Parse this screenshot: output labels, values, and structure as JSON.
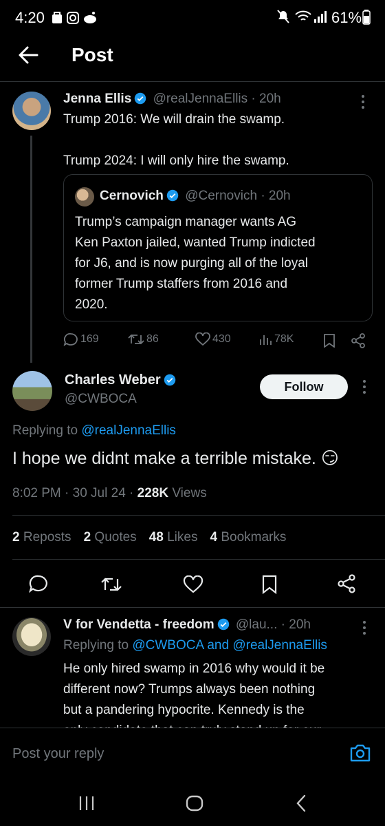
{
  "status": {
    "time": "4:20",
    "battery": "61%"
  },
  "header": {
    "title": "Post"
  },
  "tweet1": {
    "name": "Jenna Ellis",
    "handle": "@realJennaEllis",
    "time": "· 20h",
    "line1": "Trump 2016: We will drain the swamp.",
    "line2": "Trump 2024: I will only hire the swamp.",
    "quote": {
      "name": "Cernovich",
      "handle": "@Cernovich",
      "time": "· 20h",
      "lines": [
        "Trump’s campaign manager wants AG",
        "Ken Paxton jailed, wanted Trump indicted",
        "for J6, and is now purging all of the loyal",
        "former Trump staffers from 2016 and",
        "2020."
      ]
    },
    "stats": {
      "replies": "169",
      "reposts": "86",
      "likes": "430",
      "views": "78K"
    }
  },
  "main": {
    "name": "Charles Weber",
    "handle": "@CWBOCA",
    "follow_label": "Follow",
    "replying_prefix": "Replying to",
    "replying_to": "@realJennaEllis",
    "text": "I hope we didnt make a terrible mistake. 😏",
    "timestamp": "8:02 PM · 30 Jul 24 · ",
    "views_count": "228K",
    "views_label": " Views",
    "counts": [
      {
        "n": "2",
        "label": " Reposts"
      },
      {
        "n": "2",
        "label": " Quotes"
      },
      {
        "n": "48",
        "label": " Likes"
      },
      {
        "n": "4",
        "label": " Bookmarks"
      }
    ]
  },
  "reply": {
    "name": "V for Vendetta - freedom",
    "handle": "@lau...",
    "time": "· 20h",
    "replying_prefix": "Replying to",
    "replying_to": "@CWBOCA and @realJennaEllis",
    "lines": [
      "He only hired swamp in 2016 why would it be",
      "different now? Trumps always been nothing",
      "but a pandering hypocrite. Kennedy is the",
      "only candidate that can truly stand up for our"
    ]
  },
  "composer": {
    "placeholder": "Post your reply"
  },
  "colors": {
    "accent": "#1d9bf0",
    "muted": "#71767b",
    "divider": "#2f3336"
  }
}
